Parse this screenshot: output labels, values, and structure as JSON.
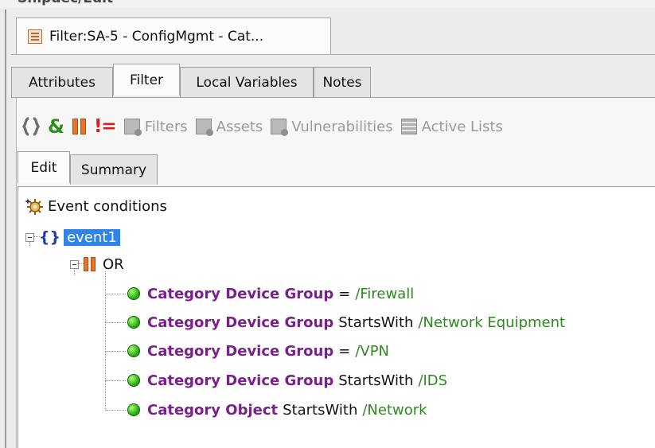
{
  "top_strip": {
    "cut_text": "Shipdec/Edit"
  },
  "document_tab": {
    "icon": "filter-doc-icon",
    "title": "Filter:SA-5 - ConfigMgmt - Cat..."
  },
  "tabs": [
    {
      "label": "Attributes",
      "active": false
    },
    {
      "label": "Filter",
      "active": true
    },
    {
      "label": "Local Variables",
      "active": false
    },
    {
      "label": "Notes",
      "active": false
    }
  ],
  "toolbar": {
    "buttons": [
      {
        "name": "braces-button",
        "icon": "braces-icon",
        "glyph": "{}",
        "color": "#6e6e6e"
      },
      {
        "name": "and-button",
        "icon": "ampersand-icon",
        "glyph": "&",
        "color": "#2f8f1d"
      },
      {
        "name": "or-button",
        "icon": "or-bars-icon",
        "glyph": "||",
        "color": "#e8742a"
      },
      {
        "name": "not-equal-button",
        "icon": "not-equal-icon",
        "glyph": "!=",
        "color": "#d91c1c"
      }
    ],
    "items": [
      {
        "label": "Filters",
        "icon": "filters-icon"
      },
      {
        "label": "Assets",
        "icon": "assets-icon"
      },
      {
        "label": "Vulnerabilities",
        "icon": "vulnerabilities-icon"
      },
      {
        "label": "Active Lists",
        "icon": "active-lists-icon"
      }
    ]
  },
  "subtabs": [
    {
      "label": "Edit",
      "active": true
    },
    {
      "label": "Summary",
      "active": false
    }
  ],
  "tree": {
    "root": {
      "label": "Event conditions",
      "icon": "gear-sparkle-icon"
    },
    "event": {
      "label": "event1",
      "icon": "braces-icon"
    },
    "operator": {
      "label": "OR",
      "icon": "or-bars-icon"
    },
    "conditions": [
      {
        "field": "Category Device Group",
        "op": "=",
        "value": "/Firewall"
      },
      {
        "field": "Category Device Group",
        "op": "StartsWith",
        "value": "/Network Equipment"
      },
      {
        "field": "Category Device Group",
        "op": "=",
        "value": "/VPN"
      },
      {
        "field": "Category Device Group",
        "op": "StartsWith",
        "value": "/IDS"
      },
      {
        "field": "Category Object",
        "op": "StartsWith",
        "value": "/Network"
      }
    ]
  },
  "colors": {
    "field": "#7a1f8c",
    "value": "#2d8a1f",
    "selection": "#2e84e8",
    "brace": "#1d3ea8"
  }
}
